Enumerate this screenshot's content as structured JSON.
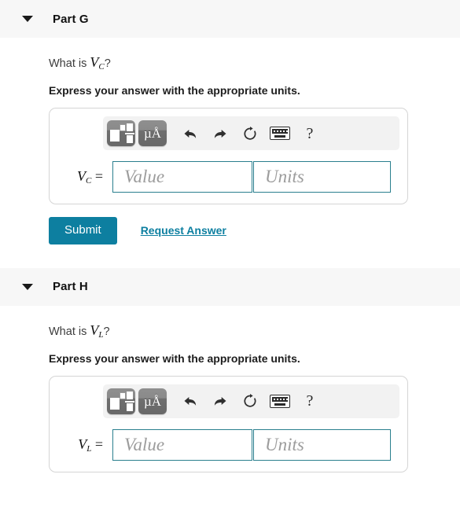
{
  "colors": {
    "accent": "#0d7fa0",
    "field_border": "#2a7f8e",
    "header_band": "#f7f7f7",
    "toolbar_bg": "#f2f2f2",
    "icon_button": "#7a7a7a",
    "placeholder_text": "#9c9c9c"
  },
  "parts": [
    {
      "id": "part-g",
      "header": {
        "title": "Part G",
        "caret_icon": "chevron-down-icon",
        "expanded": true
      },
      "question": {
        "prefix": "What is ",
        "variable": "V",
        "subscript": "C",
        "suffix": "?"
      },
      "instruction": "Express your answer with the appropriate units.",
      "toolbar": {
        "buttons": [
          {
            "name": "math-template-icon",
            "label": ""
          },
          {
            "name": "units-icon",
            "label": "µÅ"
          },
          {
            "name": "undo-icon",
            "label": "⮠"
          },
          {
            "name": "redo-icon",
            "label": "⮡"
          },
          {
            "name": "reset-icon",
            "label": "↻"
          },
          {
            "name": "keyboard-icon",
            "label": ""
          },
          {
            "name": "help-icon",
            "label": "?"
          }
        ]
      },
      "answer": {
        "label_variable": "V",
        "label_subscript": "C",
        "label_equals": "=",
        "value_placeholder": "Value",
        "value": "",
        "units_placeholder": "Units",
        "units": ""
      },
      "actions": {
        "submit_label": "Submit",
        "request_answer_label": "Request Answer"
      }
    },
    {
      "id": "part-h",
      "header": {
        "title": "Part H",
        "caret_icon": "chevron-down-icon",
        "expanded": true
      },
      "question": {
        "prefix": "What is ",
        "variable": "V",
        "subscript": "L",
        "suffix": "?"
      },
      "instruction": "Express your answer with the appropriate units.",
      "toolbar": {
        "buttons": [
          {
            "name": "math-template-icon",
            "label": ""
          },
          {
            "name": "units-icon",
            "label": "µÅ"
          },
          {
            "name": "undo-icon",
            "label": "⮠"
          },
          {
            "name": "redo-icon",
            "label": "⮡"
          },
          {
            "name": "reset-icon",
            "label": "↻"
          },
          {
            "name": "keyboard-icon",
            "label": ""
          },
          {
            "name": "help-icon",
            "label": "?"
          }
        ]
      },
      "answer": {
        "label_variable": "V",
        "label_subscript": "L",
        "label_equals": "=",
        "value_placeholder": "Value",
        "value": "",
        "units_placeholder": "Units",
        "units": ""
      }
    }
  ]
}
